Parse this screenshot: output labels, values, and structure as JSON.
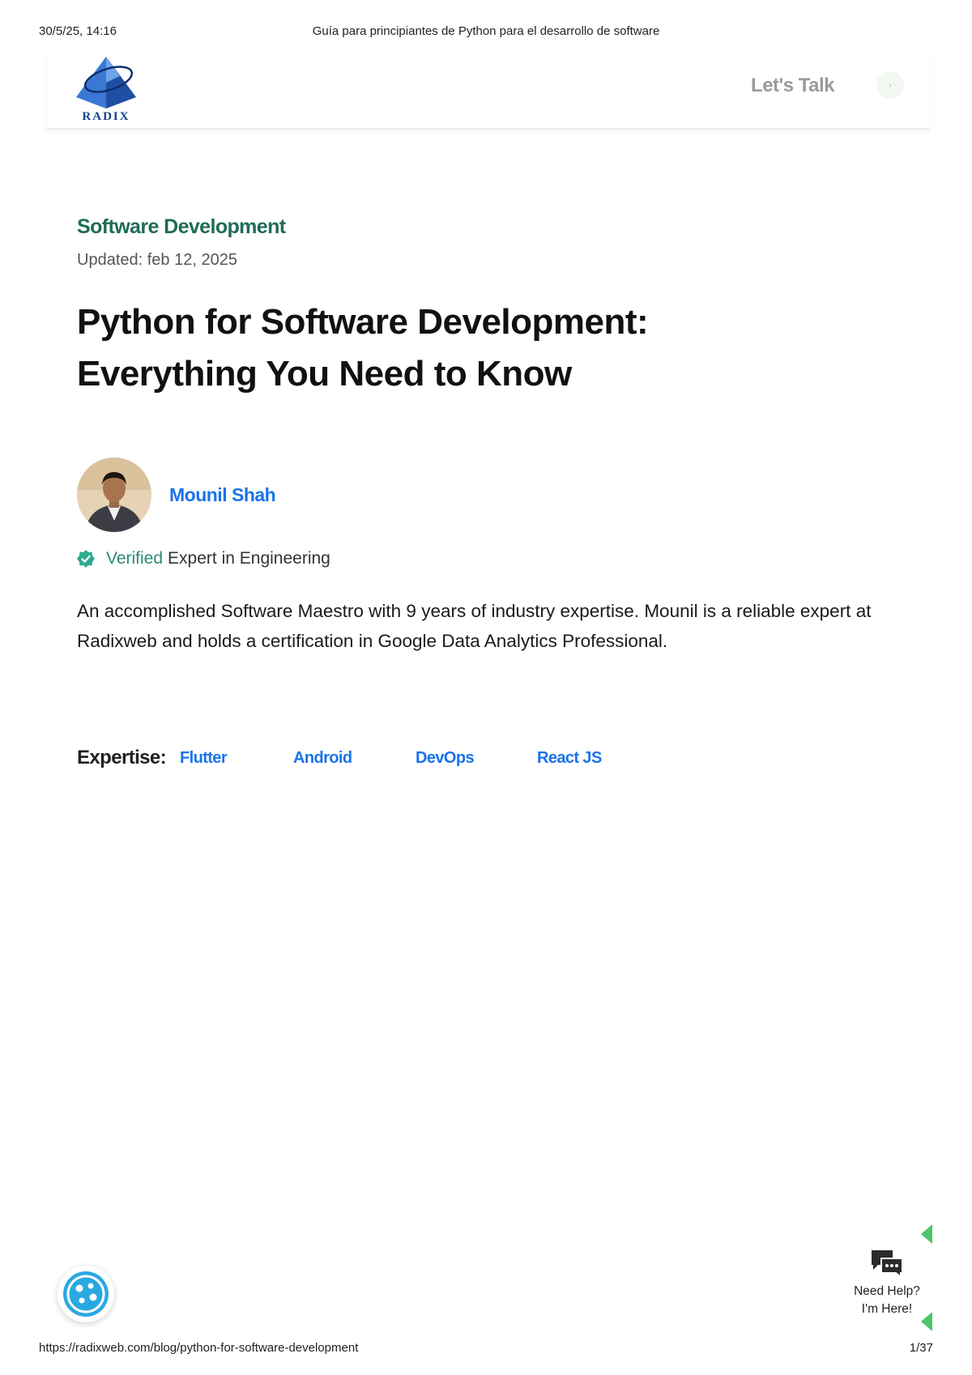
{
  "print_header": {
    "datetime": "30/5/25, 14:16",
    "document_title": "Guía para principiantes de Python para el desarrollo de software"
  },
  "site_header": {
    "logo_text": "RADIX",
    "cta_label": "Let's Talk",
    "cta_arrow": "›",
    "icons": [
      "radix-logo",
      "arrow-right-icon"
    ]
  },
  "article": {
    "category": "Software Development",
    "updated": "Updated: feb 12, 2025",
    "title_line1": "Python for Software Development:",
    "title_line2": "Everything You Need to Know"
  },
  "author": {
    "name": "Mounil Shah",
    "verified_word": "Verified",
    "verified_rest": "Expert in Engineering",
    "bio": "An accomplished Software Maestro with 9 years of industry expertise. Mounil is a reliable expert at Radixweb and holds a certification in Google Data Analytics Professional."
  },
  "expertise": {
    "label": "Expertise:",
    "tags": [
      "Flutter",
      "Android",
      "DevOps",
      "React JS"
    ]
  },
  "widgets": {
    "help_line1": "Need Help?",
    "help_line2": "I'm Here!"
  },
  "print_footer": {
    "url": "https://radixweb.com/blog/python-for-software-development",
    "page": "1/37"
  },
  "colors": {
    "category_green": "#1f6b56",
    "link_blue": "#1a73e8",
    "verified_teal": "#2a8a76",
    "logo_blue": "#14448e",
    "widget_green": "#4cc66a",
    "cookie_blue": "#29a9e1"
  }
}
